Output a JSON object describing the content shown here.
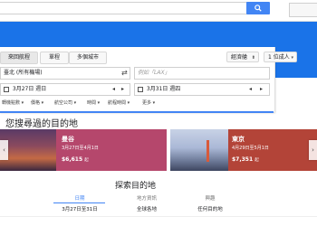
{
  "form": {
    "trip_types": [
      "來回航程",
      "單程",
      "多個城市"
    ],
    "cabin": "經濟艙",
    "passengers": "1 位成人",
    "origin": "臺北 (所有機場)",
    "destination_placeholder": "例如「LAX」",
    "depart_date": "3月27日 週日",
    "return_date": "3月31日 週四",
    "filters": [
      "轉機點數",
      "價格",
      "航空公司",
      "時間",
      "航程時間",
      "更多"
    ]
  },
  "section_title": "您搜尋過的目的地",
  "destinations": [
    {
      "city": "曼谷",
      "dates": "3月27日至4月1日",
      "price": "$6,615",
      "currency": "起"
    },
    {
      "city": "東京",
      "dates": "4月29日至5月1日",
      "price": "$7,351",
      "currency": "起"
    }
  ],
  "explore": {
    "title": "探索目的地",
    "columns": [
      {
        "label": "日期",
        "value": "3月27日至31日"
      },
      {
        "label": "地方資訊",
        "value": "全球各地"
      },
      {
        "label": "興趣",
        "value": "任何目的地"
      }
    ]
  },
  "colors": {
    "accent": "#4285f4",
    "header": "#1a73e8",
    "bangkok_tile": "#b5476c",
    "tokyo_tile": "#b34438"
  },
  "icons": [
    "search-icon",
    "swap-icon",
    "plus-icon",
    "calendar-icon",
    "chevron-left-icon",
    "chevron-right-icon",
    "chevron-down-icon"
  ]
}
